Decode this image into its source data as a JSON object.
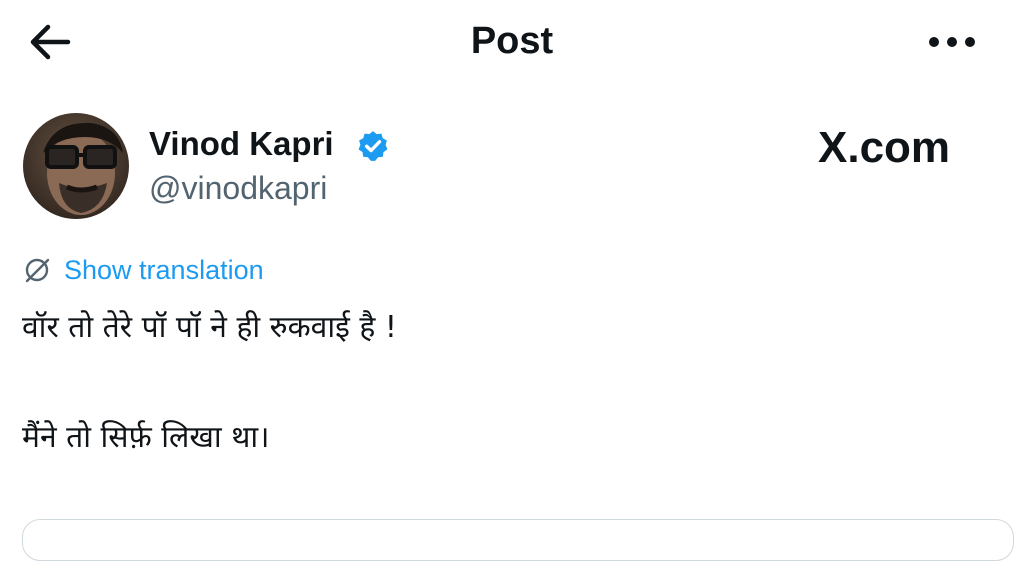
{
  "header": {
    "title": "Post",
    "back_icon": "arrow-left-icon",
    "more_icon": "more-horizontal-icon"
  },
  "author": {
    "name": "Vinod Kapri",
    "handle": "@vinodkapri",
    "verified": true,
    "verified_color": "#1d9bf0"
  },
  "watermark": {
    "text": "X.com"
  },
  "translation": {
    "label": "Show translation",
    "icon": "translate-globe-icon",
    "color": "#1d9bf0"
  },
  "post": {
    "line1": "वॉर तो तेरे पॉ पॉ ने ही रुकवाई है !",
    "line2": "मैंने तो सिर्फ़ लिखा था।"
  }
}
